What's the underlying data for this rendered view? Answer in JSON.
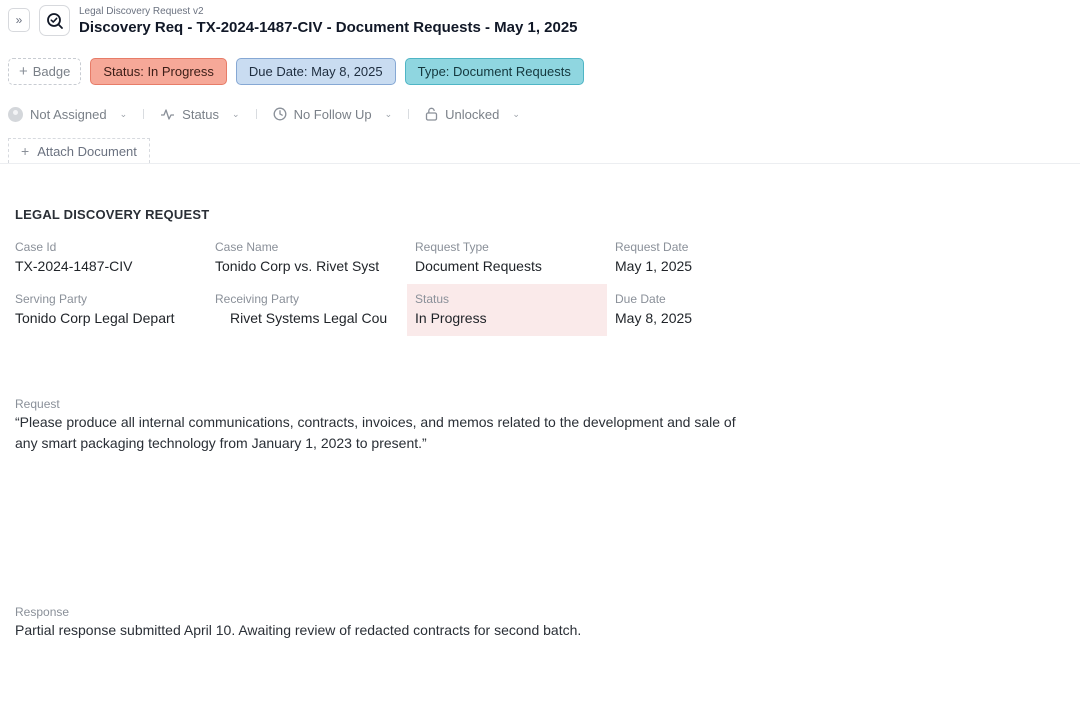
{
  "header": {
    "subtitle": "Legal Discovery Request v2",
    "title": "Discovery Req - TX-2024-1487-CIV - Document Requests - May 1, 2025",
    "expand_icon": "double-chevron-right-icon",
    "app_icon": "search-check-icon"
  },
  "badges": {
    "add_label": "Badge",
    "status": "Status: In Progress",
    "due": "Due Date: May 8, 2025",
    "type": "Type: Document Requests",
    "colors": {
      "status": "#f6a898",
      "due": "#c9dcf1",
      "type": "#8fd6e0"
    }
  },
  "meta": {
    "assignee": "Not Assigned",
    "status": "Status",
    "follow_up": "No Follow Up",
    "lock": "Unlocked"
  },
  "attach": {
    "label": "Attach Document"
  },
  "record": {
    "section_title": "LEGAL DISCOVERY REQUEST",
    "fields": [
      {
        "label": "Case Id",
        "value": "TX-2024-1487-CIV"
      },
      {
        "label": "Case Name",
        "value": "Tonido Corp vs. Rivet Syst"
      },
      {
        "label": "Request Type",
        "value": "Document Requests"
      },
      {
        "label": "Request Date",
        "value": "May 1, 2025"
      },
      {
        "label": "Serving Party",
        "value": "Tonido Corp Legal Depart"
      },
      {
        "label": "Receiving Party",
        "value": "Rivet Systems Legal Cou"
      },
      {
        "label": "Status",
        "value": "In Progress"
      },
      {
        "label": "Due Date",
        "value": "May 8, 2025"
      }
    ],
    "request": {
      "label": "Request",
      "line1": "“Please produce all internal communications, contracts, invoices, and memos related to the development and sale of",
      "line2": "any smart packaging technology from January 1, 2023 to present.”"
    },
    "response": {
      "label": "Response",
      "value": "Partial response submitted April 10. Awaiting review of redacted contracts for second batch."
    }
  }
}
